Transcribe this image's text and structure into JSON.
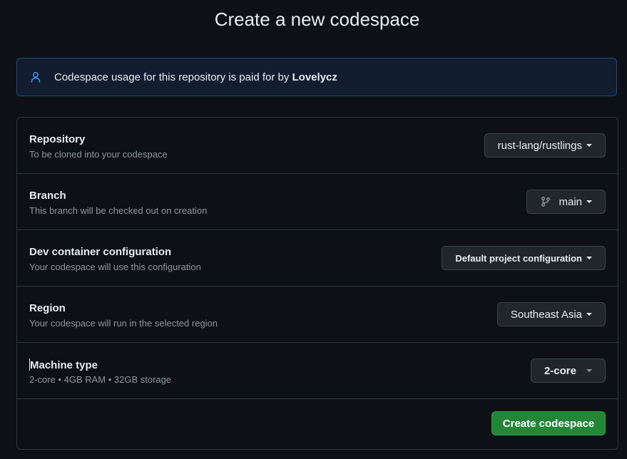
{
  "page": {
    "title": "Create a new codespace"
  },
  "notice": {
    "icon": "person-icon",
    "text_prefix": "Codespace usage for this repository is paid for by ",
    "owner": "Lovelycz"
  },
  "rows": {
    "repository": {
      "title": "Repository",
      "subtitle": "To be cloned into your codespace",
      "value": "rust-lang/rustlings"
    },
    "branch": {
      "title": "Branch",
      "subtitle": "This branch will be checked out on creation",
      "value": "main",
      "icon": "git-branch-icon"
    },
    "devcontainer": {
      "title": "Dev container configuration",
      "subtitle": "Your codespace will use this configuration",
      "value": "Default project configuration"
    },
    "region": {
      "title": "Region",
      "subtitle": "Your codespace will run in the selected region",
      "value": "Southeast Asia"
    },
    "machine": {
      "title": "Machine type",
      "subtitle": "2-core • 4GB RAM • 32GB storage",
      "value": "2-core"
    }
  },
  "actions": {
    "create_label": "Create codespace"
  },
  "colors": {
    "background": "#0d1117",
    "accent_blue": "#4493f8",
    "primary_green": "#238636",
    "border": "#30363d"
  }
}
